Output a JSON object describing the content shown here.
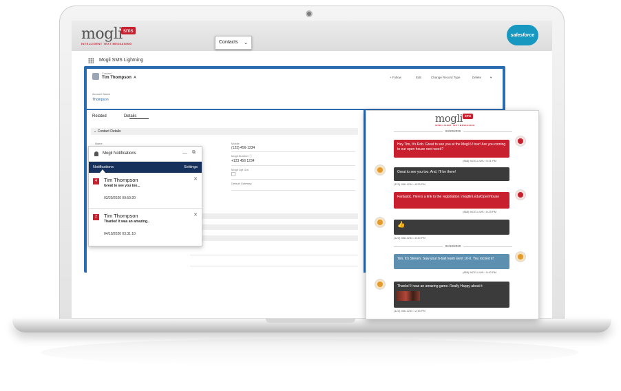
{
  "brand": {
    "logo_word": "mogli",
    "logo_sms": "sms",
    "logo_tagline": "INTELLIGENT TEXT MESSAGING",
    "partner": "salesforce"
  },
  "app": {
    "name": "Mogli SMS Lightning",
    "nav_tab": "Contacts"
  },
  "record": {
    "kicker": "Contact",
    "name": "Tim Thompson",
    "initial": "A",
    "actions": [
      "+ Follow",
      "Edit",
      "Change Record Type",
      "Delete"
    ],
    "account_label": "Account Name",
    "account_value": "Thompson"
  },
  "detail": {
    "tabs": [
      "Related",
      "Details"
    ],
    "section": "Contact Details",
    "fields": {
      "name_label": "Name",
      "mobile_label": "Mobile",
      "mobile_value": "(123) 456-1234",
      "mogli_number_label": "Mogli Number",
      "mogli_number_value": "+123 456 1234",
      "optout_label": "Mogli Opt Out",
      "gateway_label": "Default Gateway"
    }
  },
  "notifications": {
    "title": "Mogli Notifications",
    "bar_left": "Notifications",
    "bar_right": "Settings",
    "items": [
      {
        "badge": "4",
        "name": "Tim Thompson",
        "message": "Great to see you too...",
        "time": "03/20/2020 09:59:20"
      },
      {
        "badge": "2",
        "name": "Tim Thompson",
        "message": "Thanks! It was an amazing..",
        "time": "04/10/2020 03:31:10"
      }
    ]
  },
  "chat": {
    "dates": [
      "03/20/2020",
      "04/10/2020"
    ],
    "messages": [
      {
        "side": "out",
        "color": "red",
        "text": "Hey Tim, It's Rob. Great to see you at the Mogli U tour! Are you coming to our open house next week?",
        "meta": "(888) MOG-LIUN • 9:21 PM"
      },
      {
        "side": "in",
        "color": "dark",
        "text": "Great to see you too. And, I'll be there!",
        "meta": "(123) 456-1234 • 8:25 PM"
      },
      {
        "side": "out",
        "color": "red",
        "text": "Fantastic. Here's a link to the registration: moglilni.edu/OpenHouse",
        "meta": "(888) MOG-LIUN • 8:25 PM"
      },
      {
        "side": "in",
        "color": "dark",
        "text": "",
        "meta": "(123) 456-1234 • 6:40 PM"
      },
      {
        "side": "out",
        "color": "blue",
        "text": "Tim, It's Steven. Saw your b-ball team went 10-0. You rocked it!",
        "meta": "(888) MOG-LIUN • 5:40 PM"
      },
      {
        "side": "in",
        "color": "dark",
        "text": "Thanks! It was an amazing game. Really Happy about it",
        "meta": "(123) 456-1234 • 2:45 PM"
      }
    ]
  },
  "colors": {
    "mogli_red": "#c8202f",
    "lightning_blue": "#2b6bb0",
    "notif_navy": "#16325c",
    "bubble_dark": "#3b3b3b",
    "bubble_blue": "#5d8fb0"
  }
}
